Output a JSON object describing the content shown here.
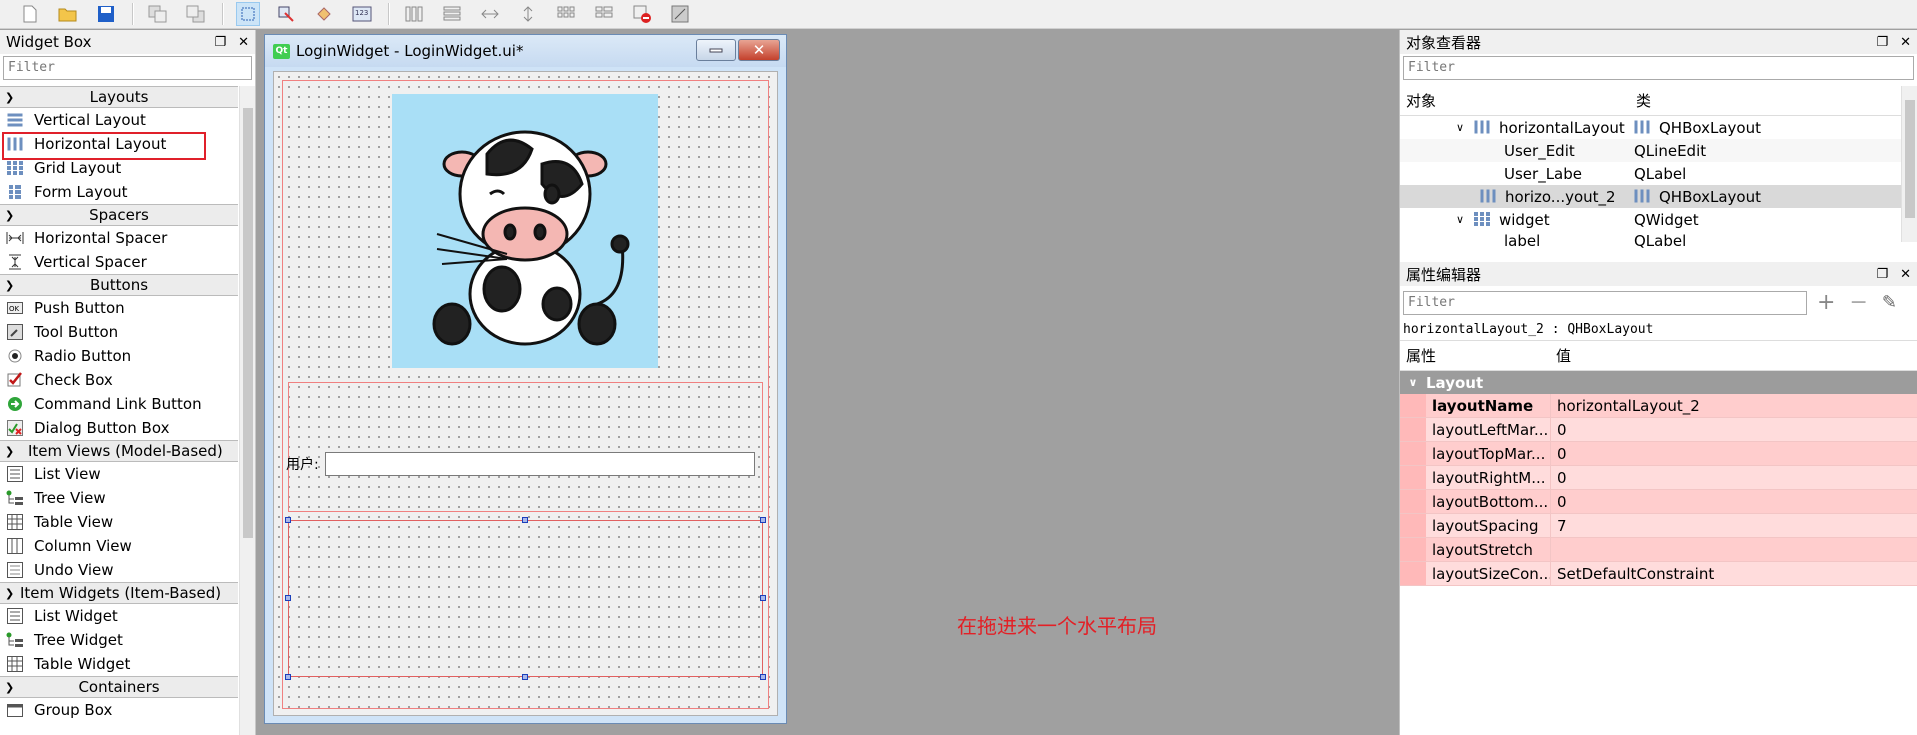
{
  "widget_box": {
    "title": "Widget Box",
    "filter_placeholder": "Filter",
    "categories": {
      "layouts": "Layouts",
      "spacers": "Spacers",
      "buttons": "Buttons",
      "item_views": "Item Views (Model-Based)",
      "item_widgets": "Item Widgets (Item-Based)",
      "containers": "Containers"
    },
    "items": {
      "vertical_layout": "Vertical Layout",
      "horizontal_layout": "Horizontal Layout",
      "grid_layout": "Grid Layout",
      "form_layout": "Form Layout",
      "horizontal_spacer": "Horizontal Spacer",
      "vertical_spacer": "Vertical Spacer",
      "push_button": "Push Button",
      "tool_button": "Tool Button",
      "radio_button": "Radio Button",
      "check_box": "Check Box",
      "command_link_button": "Command Link Button",
      "dialog_button_box": "Dialog Button Box",
      "list_view": "List View",
      "tree_view": "Tree View",
      "table_view": "Table View",
      "column_view": "Column View",
      "undo_view": "Undo View",
      "list_widget": "List Widget",
      "tree_widget": "Tree Widget",
      "table_widget": "Table Widget",
      "group_box": "Group Box"
    }
  },
  "form_window": {
    "title": "LoginWidget - LoginWidget.ui*",
    "qt_badge": "Qt",
    "user_label": "用户:"
  },
  "annotation": "在拖进来一个水平布局",
  "object_inspector": {
    "title": "对象查看器",
    "filter_placeholder": "Filter",
    "col_object": "对象",
    "col_class": "类",
    "rows": [
      {
        "name": "horizontalLayout",
        "cls": "QHBoxLayout"
      },
      {
        "name": "User_Edit",
        "cls": "QLineEdit"
      },
      {
        "name": "User_Labe",
        "cls": "QLabel"
      },
      {
        "name": "horizo...yout_2",
        "cls": "QHBoxLayout"
      },
      {
        "name": "widget",
        "cls": "QWidget"
      },
      {
        "name": "label",
        "cls": "QLabel"
      }
    ]
  },
  "property_editor": {
    "title": "属性编辑器",
    "filter_placeholder": "Filter",
    "subject": "horizontalLayout_2 : QHBoxLayout",
    "col_property": "属性",
    "col_value": "值",
    "group": "Layout",
    "rows": [
      {
        "name": "layoutName",
        "value": "horizontalLayout_2"
      },
      {
        "name": "layoutLeftMar...",
        "value": "0"
      },
      {
        "name": "layoutTopMar...",
        "value": "0"
      },
      {
        "name": "layoutRightM...",
        "value": "0"
      },
      {
        "name": "layoutBottom...",
        "value": "0"
      },
      {
        "name": "layoutSpacing",
        "value": "7"
      },
      {
        "name": "layoutStretch",
        "value": ""
      },
      {
        "name": "layoutSizeCon...",
        "value": "SetDefaultConstraint"
      }
    ]
  },
  "colors": {
    "annotation_red": "#e32026",
    "selection_red": "#e0202a",
    "property_highlight": "#ffcdcd",
    "image_bg": "#a9dff6"
  }
}
